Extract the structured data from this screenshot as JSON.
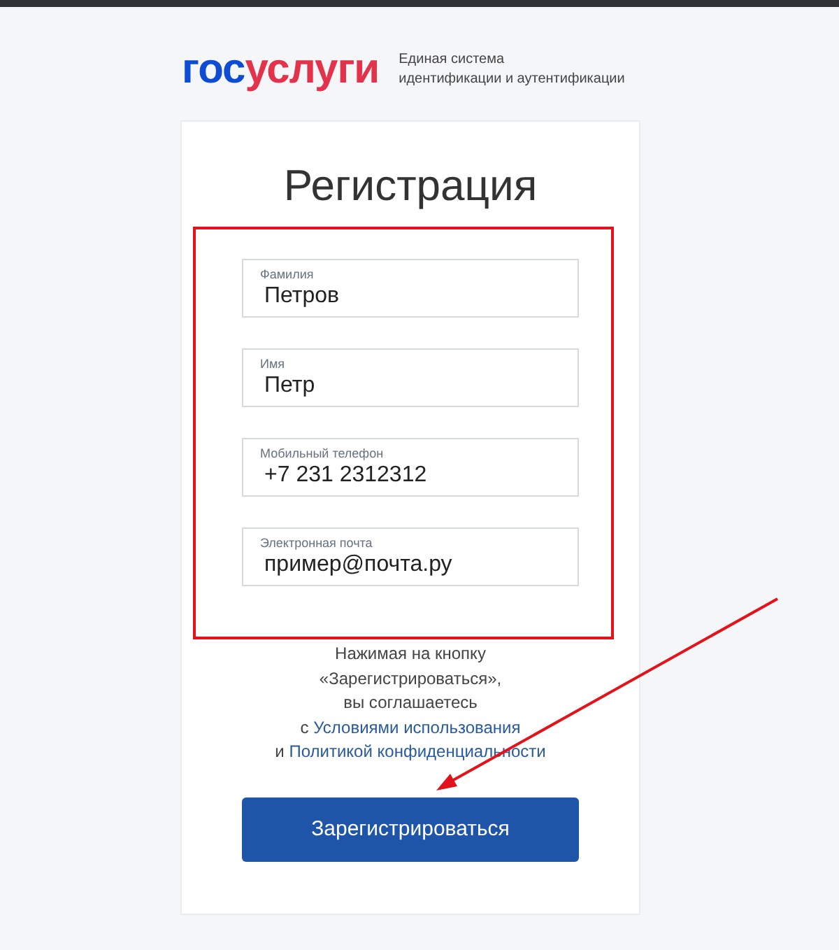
{
  "logo": {
    "parts": [
      {
        "text": "гос",
        "color": "#0d4cd3"
      },
      {
        "text": "услуги",
        "color": "#e3324b"
      }
    ],
    "tagline": [
      "Единая система",
      "идентификации и аутентификации"
    ]
  },
  "form": {
    "title": "Регистрация",
    "fields": [
      {
        "label": "Фамилия",
        "value": "Петров"
      },
      {
        "label": "Имя",
        "value": "Петр"
      },
      {
        "label": "Мобильный телефон",
        "value": "+7 231 2312312"
      },
      {
        "label": "Электронная почта",
        "value": "пример@почта.ру"
      }
    ],
    "agreement": {
      "lines": [
        "Нажимая на кнопку",
        "«Зарегистрироваться»,",
        "вы соглашаетесь"
      ],
      "terms_prefix": "с",
      "terms_link": "Условиями использования",
      "privacy_prefix": "и",
      "privacy_link": "Политикой конфиденциальности"
    },
    "submit_button": "Зарегистрироваться"
  },
  "annotations": {
    "highlight_frame": true,
    "arrow": true
  }
}
